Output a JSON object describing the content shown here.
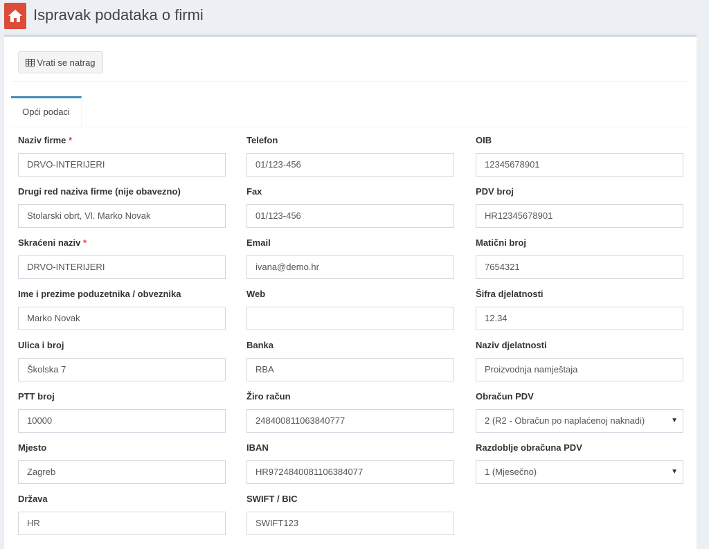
{
  "header": {
    "title": "Ispravak podataka o firmi"
  },
  "toolbar": {
    "back_label": "Vrati se natrag"
  },
  "tabs": [
    {
      "label": "Opći podaci"
    }
  ],
  "form": {
    "col1": [
      {
        "label": "Naziv firme",
        "required": "*",
        "value": "DRVO-INTERIJERI"
      },
      {
        "label": "Drugi red naziva firme (nije obavezno)",
        "value": "Stolarski obrt, Vl. Marko Novak"
      },
      {
        "label": "Skraćeni naziv",
        "required": "*",
        "value": "DRVO-INTERIJERI"
      },
      {
        "label": "Ime i prezime poduzetnika / obveznika",
        "value": "Marko Novak"
      },
      {
        "label": "Ulica i broj",
        "value": "Školska 7"
      },
      {
        "label": "PTT broj",
        "value": "10000"
      },
      {
        "label": "Mjesto",
        "value": "Zagreb"
      },
      {
        "label": "Država",
        "value": "HR"
      }
    ],
    "col2": [
      {
        "label": "Telefon",
        "value": "01/123-456"
      },
      {
        "label": "Fax",
        "value": "01/123-456"
      },
      {
        "label": "Email",
        "value": "ivana@demo.hr"
      },
      {
        "label": "Web",
        "value": ""
      },
      {
        "label": "Banka",
        "value": "RBA"
      },
      {
        "label": "Žiro račun",
        "value": "248400811063840777"
      },
      {
        "label": "IBAN",
        "value": "HR9724840081106384077"
      },
      {
        "label": "SWIFT / BIC",
        "value": "SWIFT123"
      }
    ],
    "col3": [
      {
        "label": "OIB",
        "value": "12345678901"
      },
      {
        "label": "PDV broj",
        "value": "HR12345678901"
      },
      {
        "label": "Matični broj",
        "value": "7654321"
      },
      {
        "label": "Šifra djelatnosti",
        "value": "12.34"
      },
      {
        "label": "Naziv djelatnosti",
        "value": "Proizvodnja namještaja"
      },
      {
        "label": "Obračun PDV",
        "value": "2 (R2 - Obračun po naplaćenoj naknadi)"
      },
      {
        "label": "Razdoblje obračuna PDV",
        "value": "1 (Mjesečno)"
      }
    ]
  },
  "colors": {
    "accent": "#3c8dbc",
    "home": "#dd4b39",
    "required": "#dd4b39"
  }
}
